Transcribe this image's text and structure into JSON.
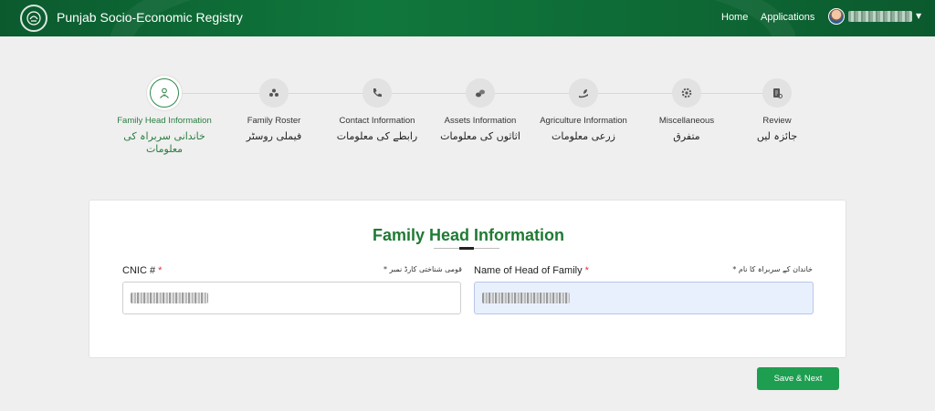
{
  "header": {
    "brand": "Punjab Socio-Economic Registry",
    "nav": {
      "home": "Home",
      "applications": "Applications"
    },
    "user": {
      "name_redacted": true
    }
  },
  "steps": [
    {
      "label": "Family Head Information",
      "urdu": "خاندانی سربراہ کی معلومات",
      "icon": "user-shield-icon",
      "active": true
    },
    {
      "label": "Family Roster",
      "urdu": "فیملی روسٹر",
      "icon": "family-group-icon",
      "active": false
    },
    {
      "label": "Contact Information",
      "urdu": "رابطے کی معلومات",
      "icon": "phone-icon",
      "active": false
    },
    {
      "label": "Assets Information",
      "urdu": "اثاثوں کی معلومات",
      "icon": "coins-icon",
      "active": false
    },
    {
      "label": "Agriculture Information",
      "urdu": "زرعی معلومات",
      "icon": "leaf-hand-icon",
      "active": false
    },
    {
      "label": "Miscellaneous",
      "urdu": "متفرق",
      "icon": "gear-icon",
      "active": false
    },
    {
      "label": "Review",
      "urdu": "جائزہ لیں",
      "icon": "document-icon",
      "active": false
    }
  ],
  "form": {
    "title": "Family Head Information",
    "cnic": {
      "label": "CNIC #",
      "required_mark": "*",
      "urdu_label": "قومی شناختی کارڈ نمبر *"
    },
    "head_name": {
      "label": "Name of Head of Family",
      "required_mark": "*",
      "urdu_label": "خاندان کے سربراہ کا نام *"
    }
  },
  "actions": {
    "save_next": "Save & Next"
  },
  "colors": {
    "header": "#0e6a35",
    "accent": "#1f7a34",
    "button": "#1e9e50"
  }
}
